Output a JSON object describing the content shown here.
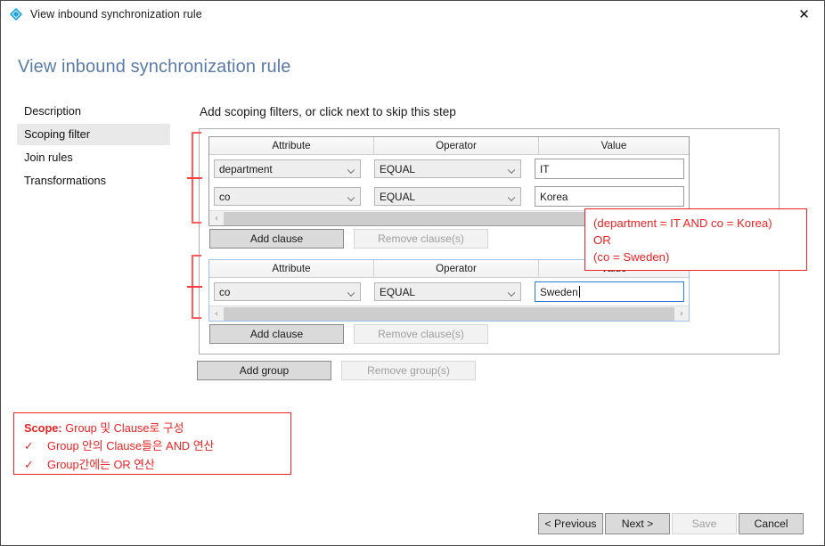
{
  "window": {
    "title": "View inbound synchronization rule",
    "icon": "sync-rule-diamond-icon",
    "close_label": "✕"
  },
  "page": {
    "heading": "View inbound synchronization rule",
    "step_heading": "Add scoping filters, or click next to skip this step"
  },
  "sidebar": {
    "items": [
      {
        "label": "Description",
        "selected": false
      },
      {
        "label": "Scoping filter",
        "selected": true
      },
      {
        "label": "Join rules",
        "selected": false
      },
      {
        "label": "Transformations",
        "selected": false
      }
    ]
  },
  "grid": {
    "columns": [
      "Attribute",
      "Operator",
      "Value"
    ]
  },
  "groups": [
    {
      "focused": false,
      "clauses": [
        {
          "attribute": "department",
          "operator": "EQUAL",
          "value": "IT",
          "focused": false
        },
        {
          "attribute": "co",
          "operator": "EQUAL",
          "value": "Korea",
          "focused": false
        }
      ],
      "add_clause_label": "Add clause",
      "remove_clause_label": "Remove clause(s)",
      "remove_clause_disabled": true
    },
    {
      "focused": true,
      "clauses": [
        {
          "attribute": "co",
          "operator": "EQUAL",
          "value": "Sweden",
          "focused": true
        }
      ],
      "add_clause_label": "Add clause",
      "remove_clause_label": "Remove clause(s)",
      "remove_clause_disabled": true
    }
  ],
  "group_actions": {
    "add_group_label": "Add group",
    "remove_group_label": "Remove group(s)",
    "remove_group_disabled": true
  },
  "annotations": {
    "formula": {
      "line1": "(department  = IT AND co = Korea)",
      "line2": "OR",
      "line3": "(co = Sweden)"
    },
    "scope": {
      "title": "Scope:",
      "title_rest": " Group 및 Clause로 구성",
      "check_glyph": "✓",
      "bullet1": "Group 안의 Clause들은 AND 연산",
      "bullet2": "Group간에는 OR 연산"
    }
  },
  "footer": {
    "previous_label": "< Previous",
    "next_label": "Next >",
    "save_label": "Save",
    "save_disabled": true,
    "cancel_label": "Cancel"
  },
  "scrollbar": {
    "left_arrow": "‹",
    "right_arrow": "›"
  },
  "colors": {
    "accent": "#5a7aa8",
    "annotation_red": "#ee2222",
    "bracket_red": "#ff5c5c",
    "focus_blue": "#2b7cd3",
    "icon_cyan": "#00a2e8"
  }
}
